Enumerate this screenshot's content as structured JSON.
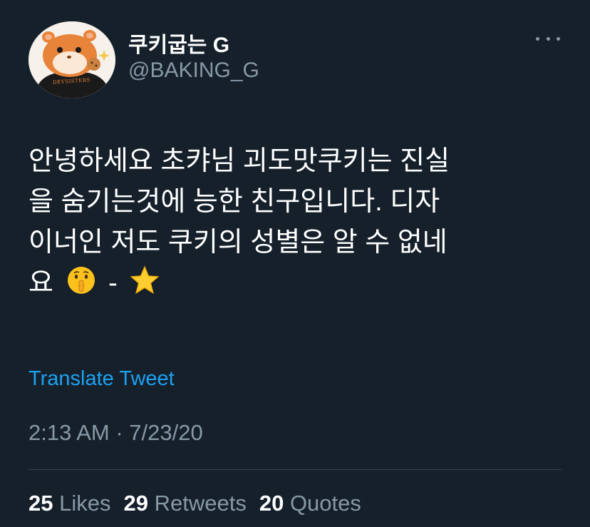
{
  "colors": {
    "background": "#15202b",
    "text_primary": "#ffffff",
    "text_secondary": "#8899a6",
    "link": "#1da1f2",
    "divider": "#38444d",
    "avatar_accent": "#e8833a"
  },
  "author": {
    "display_name": "쿠키굽는 G",
    "handle": "@BAKING_G",
    "avatar_shirt_text": "DEVSISTERS",
    "avatar_icon": "hamster-avatar-icon"
  },
  "tweet": {
    "lines": [
      "안녕하세요 초캬님 괴도맛쿠키는 진실",
      "을 숨기는것에 능한 친구입니다.  디자",
      "이너인 저도 쿠키의 성별은 알 수 없네"
    ],
    "last_line_start": "요",
    "last_line_dash": "-",
    "emoji_1": "shushing-face-emoji",
    "emoji_2": "star-emoji"
  },
  "translate_label": "Translate Tweet",
  "timestamp": "2:13 AM · 7/23/20",
  "stats": {
    "likes_count": "25",
    "likes_label": "Likes",
    "retweets_count": "29",
    "retweets_label": "Retweets",
    "quotes_count": "20",
    "quotes_label": "Quotes"
  },
  "more_icon": "more-horizontal-icon"
}
